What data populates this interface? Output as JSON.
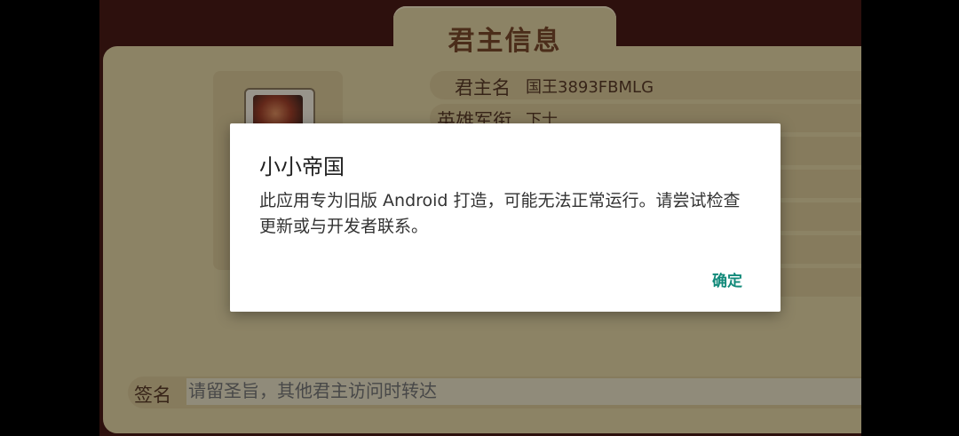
{
  "game": {
    "panel_title": "君主信息",
    "rows": [
      {
        "label": "君主名",
        "value": "国王3893FBMLG"
      },
      {
        "label": "英雄军衔",
        "value": "下士"
      }
    ],
    "signature": {
      "label": "签名",
      "placeholder": "请留圣旨，其他君主访问时转达"
    }
  },
  "dialog": {
    "title": "小小帝国",
    "message": "此应用专为旧版 Android 打造，可能无法正常运行。请尝试检查更新或与开发者联系。",
    "ok_label": "确定"
  },
  "colors": {
    "accent": "#128a7a",
    "panel": "#e3d3a4",
    "panel_text": "#5a3a28"
  }
}
